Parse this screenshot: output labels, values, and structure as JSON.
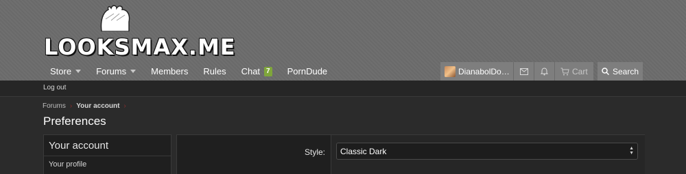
{
  "logo": {
    "text": "LOOKSMAX.ME"
  },
  "nav": {
    "items": [
      {
        "label": "Store",
        "caret": true
      },
      {
        "label": "Forums",
        "caret": true
      },
      {
        "label": "Members",
        "caret": false
      },
      {
        "label": "Rules",
        "caret": false
      },
      {
        "label": "Chat",
        "badge": "7"
      },
      {
        "label": "PornDude",
        "caret": false
      }
    ]
  },
  "user": {
    "name": "DianabolDow...",
    "cart_label": "Cart"
  },
  "search": {
    "label": "Search"
  },
  "subnav": {
    "logout_label": "Log out"
  },
  "breadcrumb": {
    "items": [
      "Forums",
      "Your account"
    ]
  },
  "page": {
    "title": "Preferences"
  },
  "sidebar": {
    "heading": "Your account",
    "items": [
      "Your profile"
    ]
  },
  "form": {
    "style_label": "Style:",
    "style_value": "Classic Dark"
  },
  "colors": {
    "header_bg": "#6c6c6c",
    "body_bg": "#2b2b2b",
    "chat_badge": "#7fa63a"
  }
}
